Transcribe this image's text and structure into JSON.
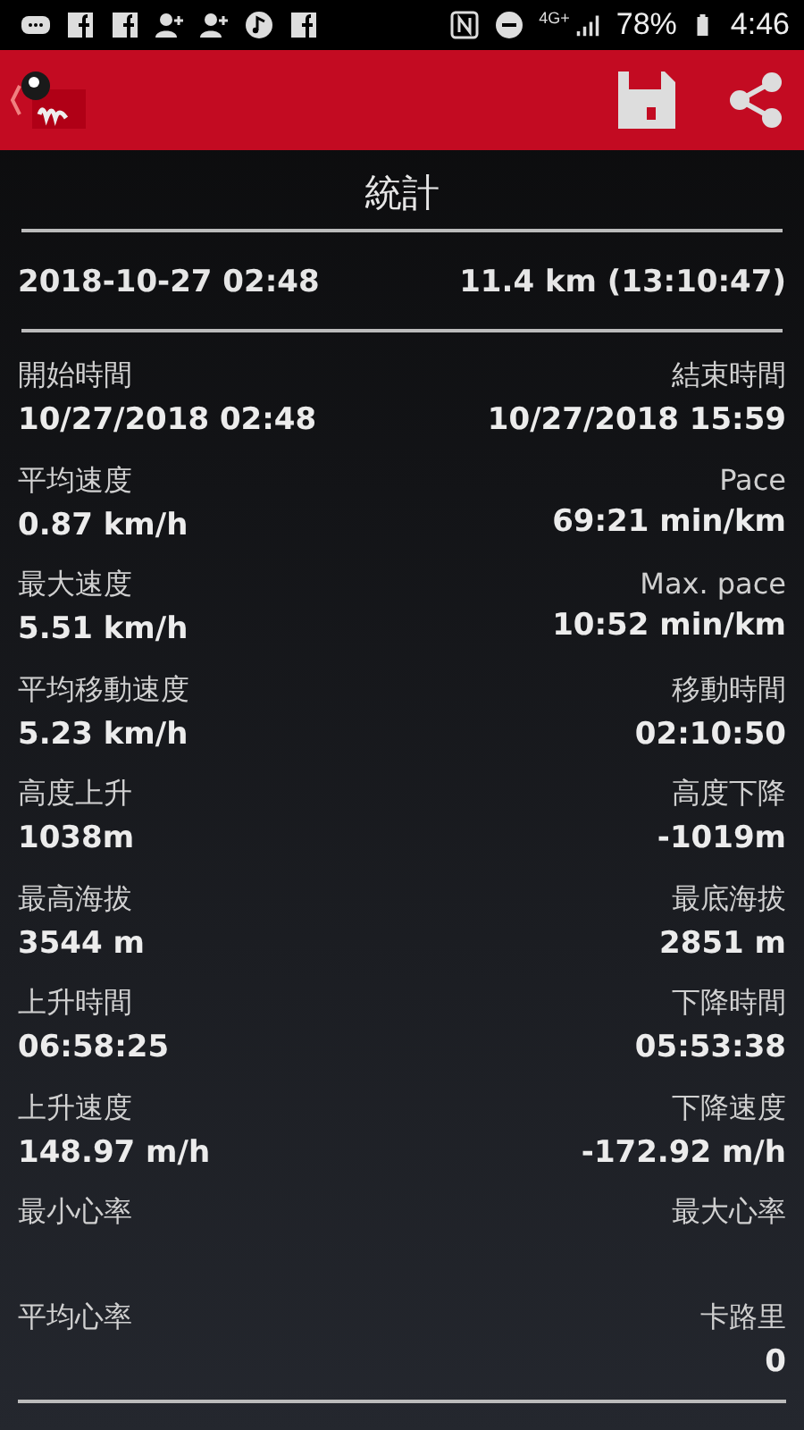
{
  "status_bar": {
    "network": "4G+",
    "battery": "78%",
    "time": "4:46"
  },
  "title": "統計",
  "summary": {
    "date": "2018-10-27 02:48",
    "distance": "11.4 km (13:10:47)"
  },
  "stats": [
    {
      "left": {
        "label": "開始時間",
        "value": "10/27/2018 02:48"
      },
      "right": {
        "label": "結束時間",
        "value": "10/27/2018 15:59"
      }
    },
    {
      "left": {
        "label": "平均速度",
        "value": "0.87 km/h"
      },
      "right": {
        "label": "Pace",
        "value": "69:21 min/km"
      }
    },
    {
      "left": {
        "label": "最大速度",
        "value": "5.51 km/h"
      },
      "right": {
        "label": "Max. pace",
        "value": "10:52 min/km"
      }
    },
    {
      "left": {
        "label": "平均移動速度",
        "value": "5.23 km/h"
      },
      "right": {
        "label": "移動時間",
        "value": "02:10:50"
      }
    },
    {
      "left": {
        "label": "高度上升",
        "value": "1038m"
      },
      "right": {
        "label": "高度下降",
        "value": "-1019m"
      }
    },
    {
      "left": {
        "label": "最高海拔",
        "value": "3544 m"
      },
      "right": {
        "label": "最底海拔",
        "value": "2851 m"
      }
    },
    {
      "left": {
        "label": "上升時間",
        "value": "06:58:25"
      },
      "right": {
        "label": "下降時間",
        "value": "05:53:38"
      }
    },
    {
      "left": {
        "label": "上升速度",
        "value": "148.97 m/h"
      },
      "right": {
        "label": "下降速度",
        "value": "-172.92 m/h"
      }
    },
    {
      "left": {
        "label": "最小心率"
      },
      "right": {
        "label": "最大心率"
      }
    },
    {
      "left": {
        "label": "平均心率"
      },
      "right": {
        "label": "卡路里",
        "value": "0"
      }
    }
  ]
}
